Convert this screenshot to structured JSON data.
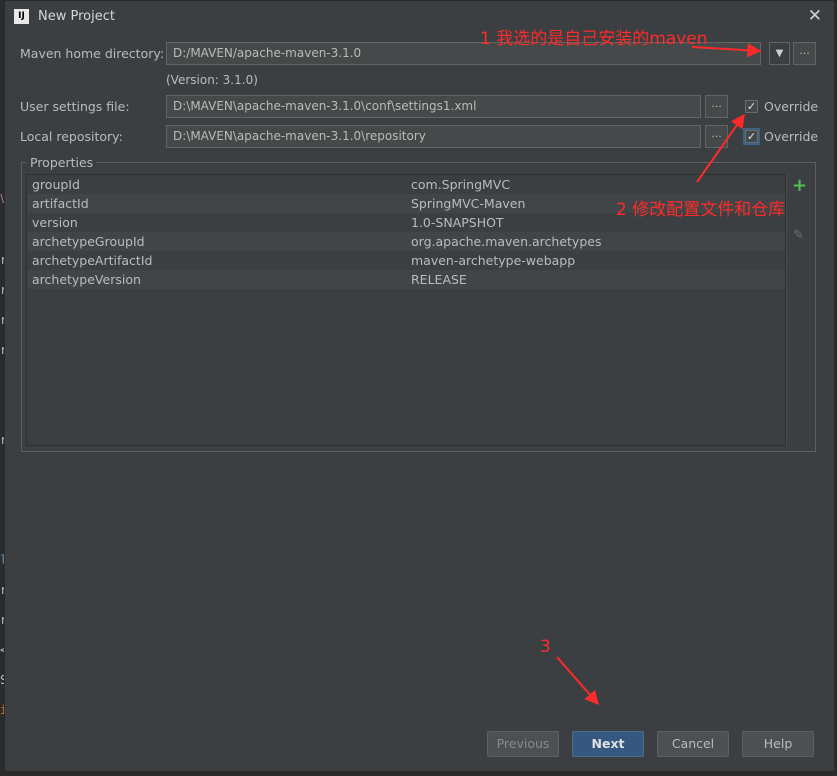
{
  "window": {
    "title": "New Project",
    "app_icon_text": "IJ",
    "close_glyph": "✕"
  },
  "maven": {
    "home_label": "Maven home directory:",
    "home_value": "D:/MAVEN/apache-maven-3.1.0",
    "version_note": "(Version: 3.1.0)",
    "settings_label": "User settings file:",
    "settings_value": "D:\\MAVEN\\apache-maven-3.1.0\\conf\\settings1.xml",
    "settings_override": "Override",
    "settings_override_checked": true,
    "repo_label": "Local repository:",
    "repo_value": "D:\\MAVEN\\apache-maven-3.1.0\\repository",
    "repo_override": "Override",
    "repo_override_checked": true,
    "browse_glyph": "...",
    "dropdown_glyph": "▼"
  },
  "properties": {
    "title": "Properties",
    "rows": [
      {
        "key": "groupId",
        "value": "com.SpringMVC"
      },
      {
        "key": "artifactId",
        "value": "SpringMVC-Maven"
      },
      {
        "key": "version",
        "value": "1.0-SNAPSHOT"
      },
      {
        "key": "archetypeGroupId",
        "value": "org.apache.maven.archetypes"
      },
      {
        "key": "archetypeArtifactId",
        "value": "maven-archetype-webapp"
      },
      {
        "key": "archetypeVersion",
        "value": "RELEASE"
      }
    ],
    "add_glyph": "+",
    "edit_glyph": "✎"
  },
  "buttons": {
    "previous": "Previous",
    "next": "Next",
    "cancel": "Cancel",
    "help": "Help"
  },
  "annotations": {
    "note1": "1 我选的是自己安装的maven",
    "note2": "2 修改配置文件和仓库",
    "note3": "3",
    "color": "#ff2a2a"
  },
  "background_glyphs": [
    "V",
    "r",
    "r",
    "r",
    "r",
    "r",
    "l",
    "r",
    "r",
    "<",
    "S",
    "i"
  ]
}
